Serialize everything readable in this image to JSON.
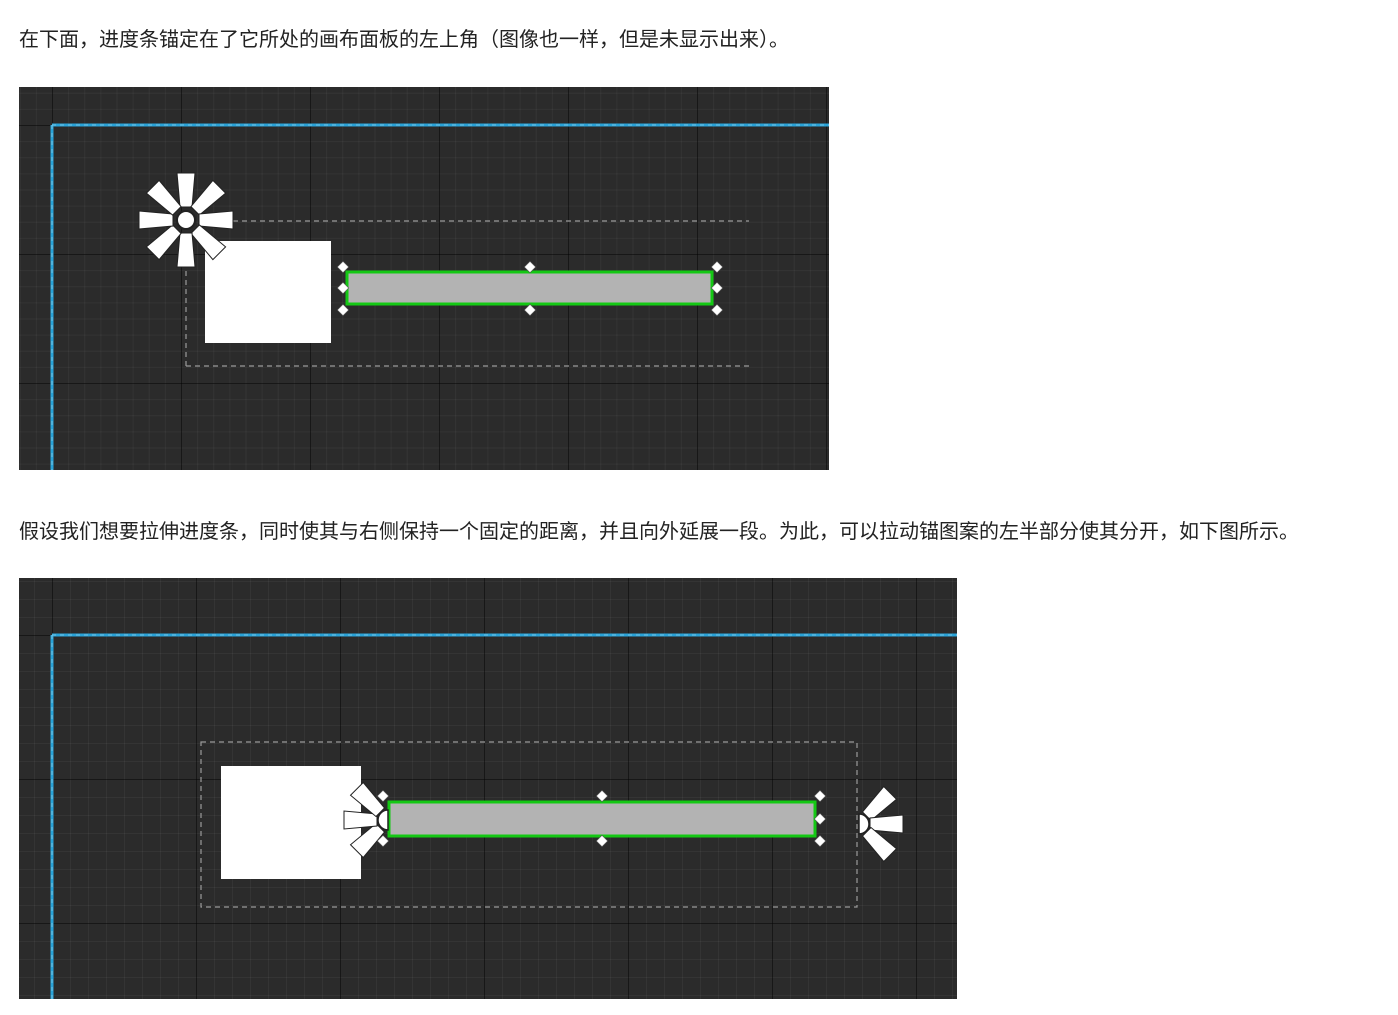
{
  "paragraphs": {
    "intro": "在下面，进度条锚定在了它所处的画布面板的左上角（图像也一样，但是未显示出来）。",
    "stretch": "假设我们想要拉伸进度条，同时使其与右侧保持一个固定的距离，并且向外延展一段。为此，可以拉动锚图案的左半部分使其分开，如下图所示。"
  },
  "colors": {
    "canvas_background": "#2b2b2b",
    "canvas_boundary": "#29a3d8",
    "progress_fill": "#b3b3b3",
    "selection_outline": "#14c814",
    "image_widget": "#ffffff",
    "anchor_icon": "#ffffff",
    "dashed_guide": "#9a9a9a"
  },
  "figures": [
    {
      "name": "anchored-top-left",
      "anchor": "top-left",
      "widgets": [
        "image",
        "progress-bar"
      ],
      "progress_bar_selected": true
    },
    {
      "name": "anchor-split-stretch",
      "anchor": "split-horizontal",
      "widgets": [
        "image",
        "progress-bar"
      ],
      "progress_bar_selected": true
    }
  ]
}
